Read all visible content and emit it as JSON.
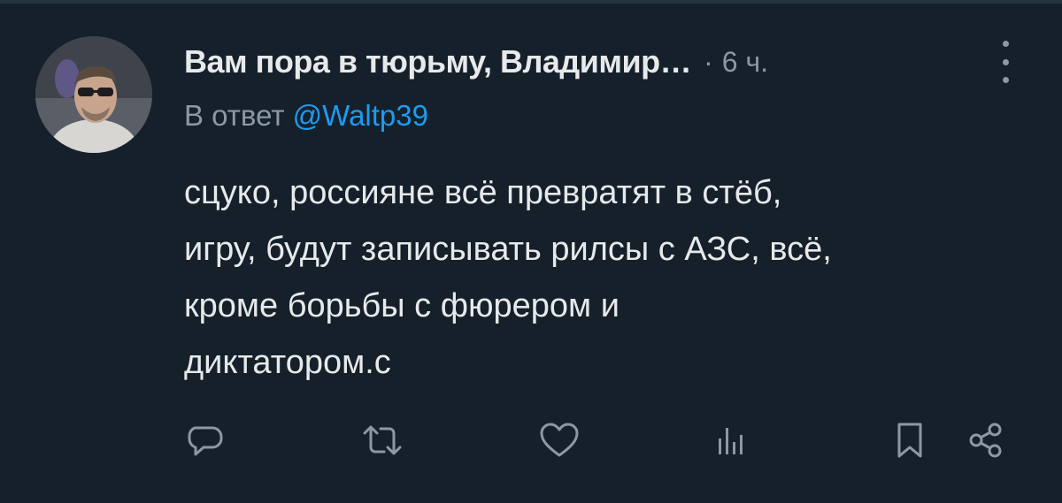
{
  "tweet": {
    "display_name": "Вам пора в тюрьму, Владимир…",
    "separator": "·",
    "time": "6 ч.",
    "reply_prefix": "В ответ",
    "reply_mention": "@Waltp39",
    "body_lines": [
      "сцуко, россияне всё превратят в стёб,",
      "игру, будут записывать рилсы с АЗС, всё,",
      "кроме борьбы с фюрером и",
      "диктатором.с"
    ]
  },
  "icons": {
    "more": "more-vertical-icon",
    "reply": "reply-icon",
    "retweet": "retweet-icon",
    "like": "like-icon",
    "views": "views-icon",
    "bookmark": "bookmark-icon",
    "share": "share-icon"
  },
  "colors": {
    "background": "#15202b",
    "text": "#e7e9ea",
    "secondary": "#8b98a5",
    "accent": "#1d9bf0"
  }
}
